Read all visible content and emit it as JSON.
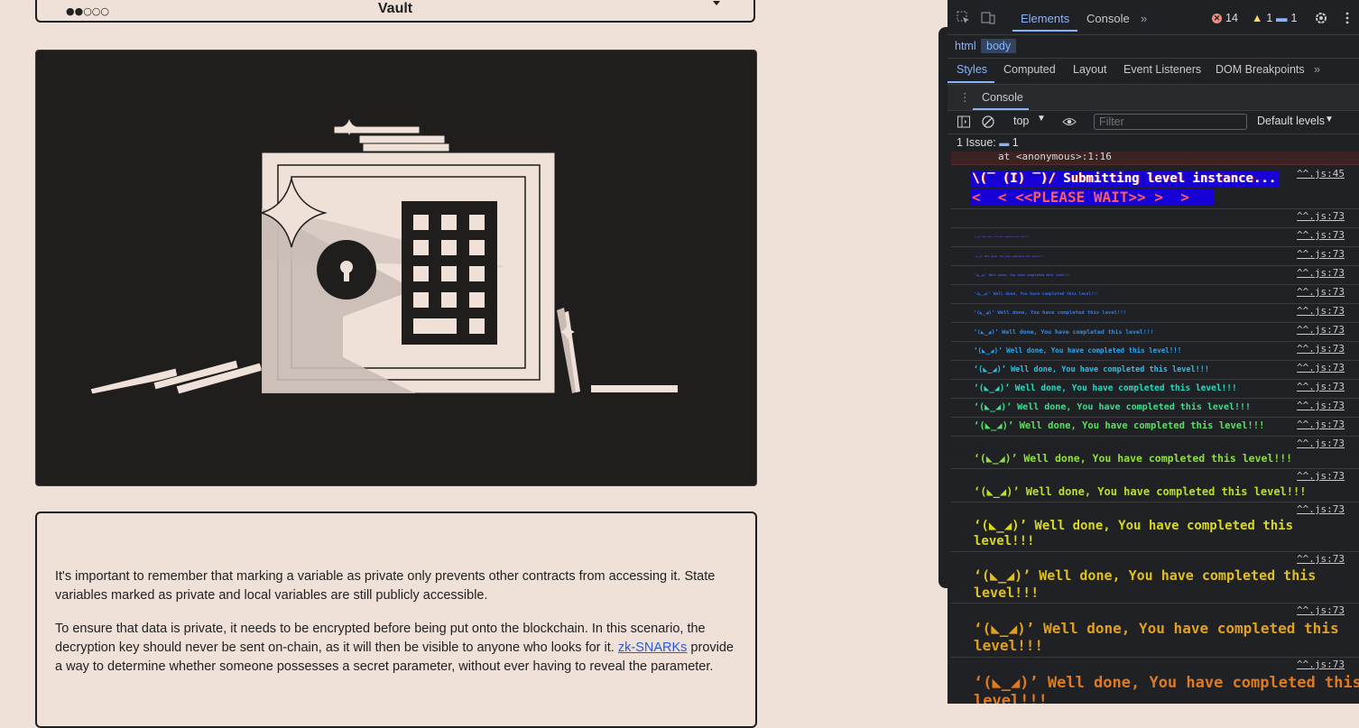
{
  "level": {
    "dots": "●●○○○",
    "title": "Vault"
  },
  "description": {
    "paragraph1": "It's important to remember that marking a variable as private only prevents other contracts from accessing it. State variables marked as private and local variables are still publicly accessible.",
    "paragraph2_before": "To ensure that data is private, it needs to be encrypted before being put onto the blockchain. In this scenario, the decryption key should never be sent on-chain, as it will then be visible to anyone who looks for it. ",
    "paragraph2_link": "zk-SNARKs",
    "paragraph2_after": " provide a way to determine whether someone possesses a secret parameter, without ever having to reveal the parameter."
  },
  "devtools": {
    "tabs": [
      "Elements",
      "Console"
    ],
    "errors": "14",
    "warnings": "1",
    "info": "1",
    "crumbs": [
      "html",
      "body"
    ],
    "subtabs": [
      "Styles",
      "Computed",
      "Layout",
      "Event Listeners",
      "DOM Breakpoints"
    ],
    "drawer_tab": "Console",
    "context": "top",
    "filter_placeholder": "Filter",
    "levels": "Default levels",
    "issues_label": "1 Issue:",
    "issues_count": "1",
    "trace_line": "at <anonymous>:1:16",
    "submit_line1": "\\(‾ (I) ‾)/ Submitting level instance...",
    "submit_line2": "<  < <<PLEASE WAIT>> >  >",
    "submit_src": "^^.js:45",
    "log_src": "^^.js:73",
    "log_message": "‘(◣_◢)’ Well done, You have completed this level!!!",
    "log_message_line1": "‘(◣_◢)’ Well done, You have completed this",
    "log_message_line2": "level!!!",
    "colors": {
      "accent": "#8ab4f8",
      "error": "#f28b82",
      "warning": "#fdd663",
      "submit_bg": "#1700d6"
    }
  }
}
